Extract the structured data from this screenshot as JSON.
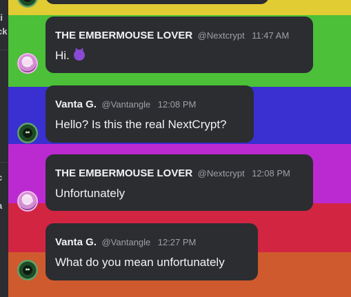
{
  "sidebar": {
    "snippets": [
      "ti",
      "ck",
      "c",
      "a"
    ]
  },
  "background": {
    "stripes": [
      "#e1cc33",
      "#4bc038",
      "#3a2fd0",
      "#bb2ad0",
      "#d22542",
      "#cf5a2e"
    ]
  },
  "messages": [
    {
      "author": "THE EMBERMOUSE LOVER",
      "handle": "@Nextcrypt",
      "time": "11:47 AM",
      "text": "Hi.",
      "emoji": "smiling-imp"
    },
    {
      "author": "Vanta G.",
      "handle": "@Vantangle",
      "time": "12:08 PM",
      "text": "Hello? Is this the real NextCrypt?"
    },
    {
      "author": "THE EMBERMOUSE LOVER",
      "handle": "@Nextcrypt",
      "time": "12:08 PM",
      "text": "Unfortunately"
    },
    {
      "author": "Vanta G.",
      "handle": "@Vantangle",
      "time": "12:27 PM",
      "text": "What do you mean unfortunately"
    }
  ]
}
